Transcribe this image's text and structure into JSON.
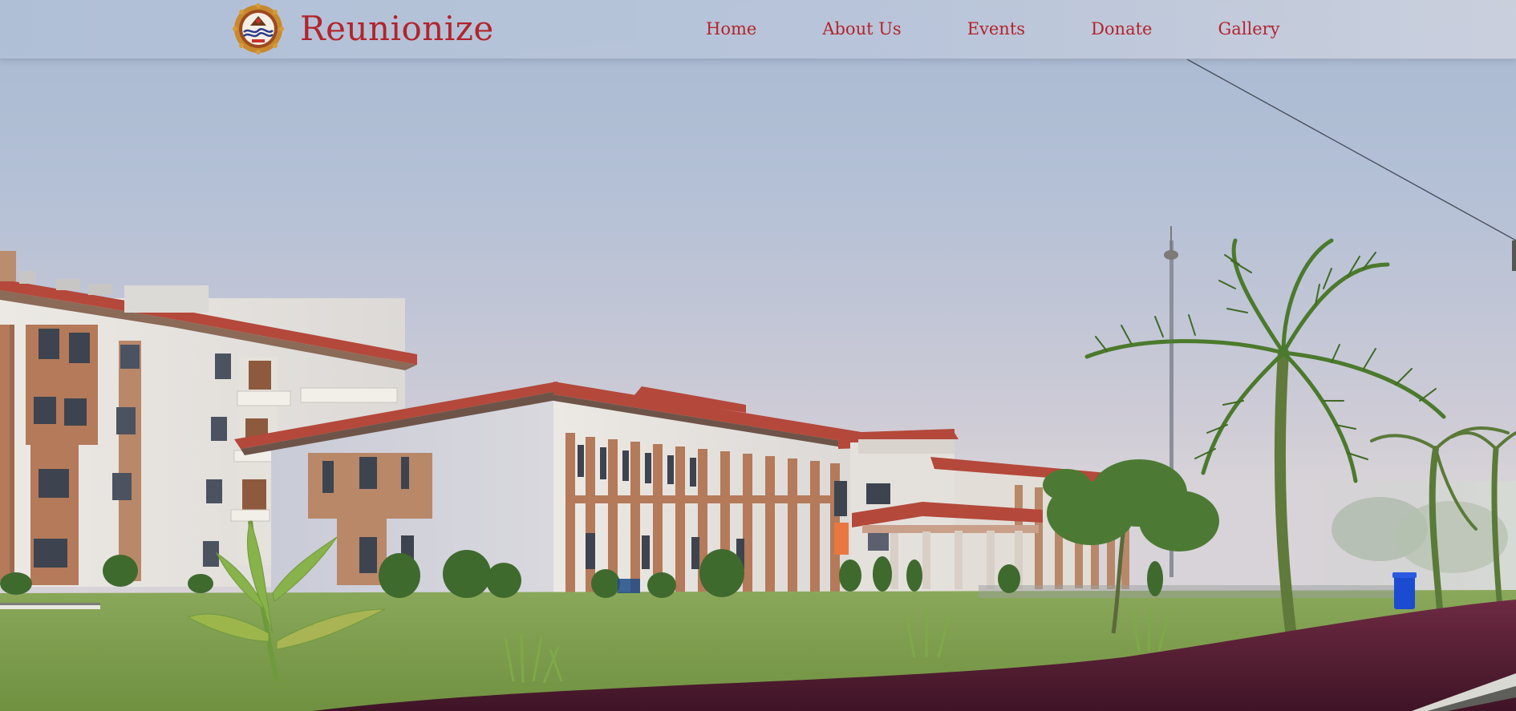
{
  "site": {
    "brand_name": "Reunionize",
    "logo_icon": "college-emblem-icon"
  },
  "nav": {
    "items": [
      {
        "label": "Home"
      },
      {
        "label": "About Us"
      },
      {
        "label": "Events"
      },
      {
        "label": "Donate"
      },
      {
        "label": "Gallery"
      }
    ]
  },
  "hero": {
    "image": "campus-building-photo"
  },
  "colors": {
    "brand_red": "#b3242b",
    "nav_bg": "#b4c2d8",
    "roof": "#b5493a",
    "wall": "#e9e6e1",
    "facade_brown": "#b47a5a",
    "lawn": "#7a9a4a",
    "hedge": "#5a1f35"
  }
}
